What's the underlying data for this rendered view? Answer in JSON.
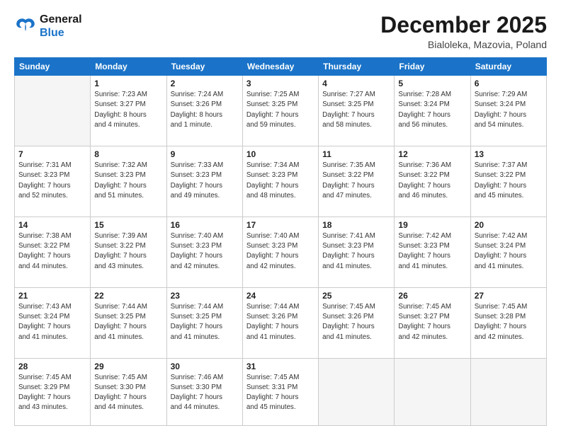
{
  "header": {
    "logo_line1": "General",
    "logo_line2": "Blue",
    "month_title": "December 2025",
    "subtitle": "Bialoleka, Mazovia, Poland"
  },
  "weekdays": [
    "Sunday",
    "Monday",
    "Tuesday",
    "Wednesday",
    "Thursday",
    "Friday",
    "Saturday"
  ],
  "weeks": [
    [
      {
        "day": "",
        "info": ""
      },
      {
        "day": "1",
        "info": "Sunrise: 7:23 AM\nSunset: 3:27 PM\nDaylight: 8 hours\nand 4 minutes."
      },
      {
        "day": "2",
        "info": "Sunrise: 7:24 AM\nSunset: 3:26 PM\nDaylight: 8 hours\nand 1 minute."
      },
      {
        "day": "3",
        "info": "Sunrise: 7:25 AM\nSunset: 3:25 PM\nDaylight: 7 hours\nand 59 minutes."
      },
      {
        "day": "4",
        "info": "Sunrise: 7:27 AM\nSunset: 3:25 PM\nDaylight: 7 hours\nand 58 minutes."
      },
      {
        "day": "5",
        "info": "Sunrise: 7:28 AM\nSunset: 3:24 PM\nDaylight: 7 hours\nand 56 minutes."
      },
      {
        "day": "6",
        "info": "Sunrise: 7:29 AM\nSunset: 3:24 PM\nDaylight: 7 hours\nand 54 minutes."
      }
    ],
    [
      {
        "day": "7",
        "info": "Sunrise: 7:31 AM\nSunset: 3:23 PM\nDaylight: 7 hours\nand 52 minutes."
      },
      {
        "day": "8",
        "info": "Sunrise: 7:32 AM\nSunset: 3:23 PM\nDaylight: 7 hours\nand 51 minutes."
      },
      {
        "day": "9",
        "info": "Sunrise: 7:33 AM\nSunset: 3:23 PM\nDaylight: 7 hours\nand 49 minutes."
      },
      {
        "day": "10",
        "info": "Sunrise: 7:34 AM\nSunset: 3:23 PM\nDaylight: 7 hours\nand 48 minutes."
      },
      {
        "day": "11",
        "info": "Sunrise: 7:35 AM\nSunset: 3:22 PM\nDaylight: 7 hours\nand 47 minutes."
      },
      {
        "day": "12",
        "info": "Sunrise: 7:36 AM\nSunset: 3:22 PM\nDaylight: 7 hours\nand 46 minutes."
      },
      {
        "day": "13",
        "info": "Sunrise: 7:37 AM\nSunset: 3:22 PM\nDaylight: 7 hours\nand 45 minutes."
      }
    ],
    [
      {
        "day": "14",
        "info": "Sunrise: 7:38 AM\nSunset: 3:22 PM\nDaylight: 7 hours\nand 44 minutes."
      },
      {
        "day": "15",
        "info": "Sunrise: 7:39 AM\nSunset: 3:22 PM\nDaylight: 7 hours\nand 43 minutes."
      },
      {
        "day": "16",
        "info": "Sunrise: 7:40 AM\nSunset: 3:23 PM\nDaylight: 7 hours\nand 42 minutes."
      },
      {
        "day": "17",
        "info": "Sunrise: 7:40 AM\nSunset: 3:23 PM\nDaylight: 7 hours\nand 42 minutes."
      },
      {
        "day": "18",
        "info": "Sunrise: 7:41 AM\nSunset: 3:23 PM\nDaylight: 7 hours\nand 41 minutes."
      },
      {
        "day": "19",
        "info": "Sunrise: 7:42 AM\nSunset: 3:23 PM\nDaylight: 7 hours\nand 41 minutes."
      },
      {
        "day": "20",
        "info": "Sunrise: 7:42 AM\nSunset: 3:24 PM\nDaylight: 7 hours\nand 41 minutes."
      }
    ],
    [
      {
        "day": "21",
        "info": "Sunrise: 7:43 AM\nSunset: 3:24 PM\nDaylight: 7 hours\nand 41 minutes."
      },
      {
        "day": "22",
        "info": "Sunrise: 7:44 AM\nSunset: 3:25 PM\nDaylight: 7 hours\nand 41 minutes."
      },
      {
        "day": "23",
        "info": "Sunrise: 7:44 AM\nSunset: 3:25 PM\nDaylight: 7 hours\nand 41 minutes."
      },
      {
        "day": "24",
        "info": "Sunrise: 7:44 AM\nSunset: 3:26 PM\nDaylight: 7 hours\nand 41 minutes."
      },
      {
        "day": "25",
        "info": "Sunrise: 7:45 AM\nSunset: 3:26 PM\nDaylight: 7 hours\nand 41 minutes."
      },
      {
        "day": "26",
        "info": "Sunrise: 7:45 AM\nSunset: 3:27 PM\nDaylight: 7 hours\nand 42 minutes."
      },
      {
        "day": "27",
        "info": "Sunrise: 7:45 AM\nSunset: 3:28 PM\nDaylight: 7 hours\nand 42 minutes."
      }
    ],
    [
      {
        "day": "28",
        "info": "Sunrise: 7:45 AM\nSunset: 3:29 PM\nDaylight: 7 hours\nand 43 minutes."
      },
      {
        "day": "29",
        "info": "Sunrise: 7:45 AM\nSunset: 3:30 PM\nDaylight: 7 hours\nand 44 minutes."
      },
      {
        "day": "30",
        "info": "Sunrise: 7:46 AM\nSunset: 3:30 PM\nDaylight: 7 hours\nand 44 minutes."
      },
      {
        "day": "31",
        "info": "Sunrise: 7:45 AM\nSunset: 3:31 PM\nDaylight: 7 hours\nand 45 minutes."
      },
      {
        "day": "",
        "info": ""
      },
      {
        "day": "",
        "info": ""
      },
      {
        "day": "",
        "info": ""
      }
    ]
  ]
}
